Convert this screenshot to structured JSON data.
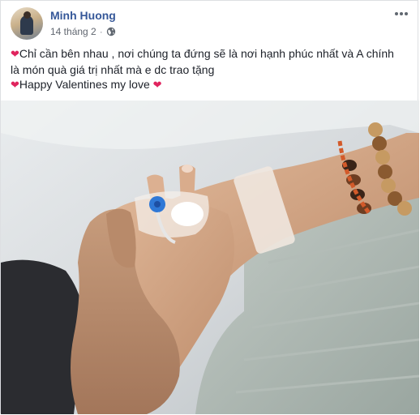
{
  "post": {
    "author": "Minh Huong",
    "date": "14 tháng 2",
    "separator": "·",
    "privacy_icon": "globe-icon",
    "more_icon": "more-options-icon",
    "text_line1": "Chỉ cần bên nhau , nơi chúng ta đứng sẽ là nơi hạnh phúc nhất và A chính",
    "text_line2": "là món quà giá trị nhất mà e dc trao tặng",
    "text_line3": "Happy Valentines my love",
    "heart_emoji": "❤",
    "photo_icon": "hands-photo"
  },
  "colors": {
    "author_link": "#365899",
    "meta_text": "#616770",
    "body_text": "#1d2129",
    "heart": "#e0245e",
    "border": "#dddfe2"
  }
}
